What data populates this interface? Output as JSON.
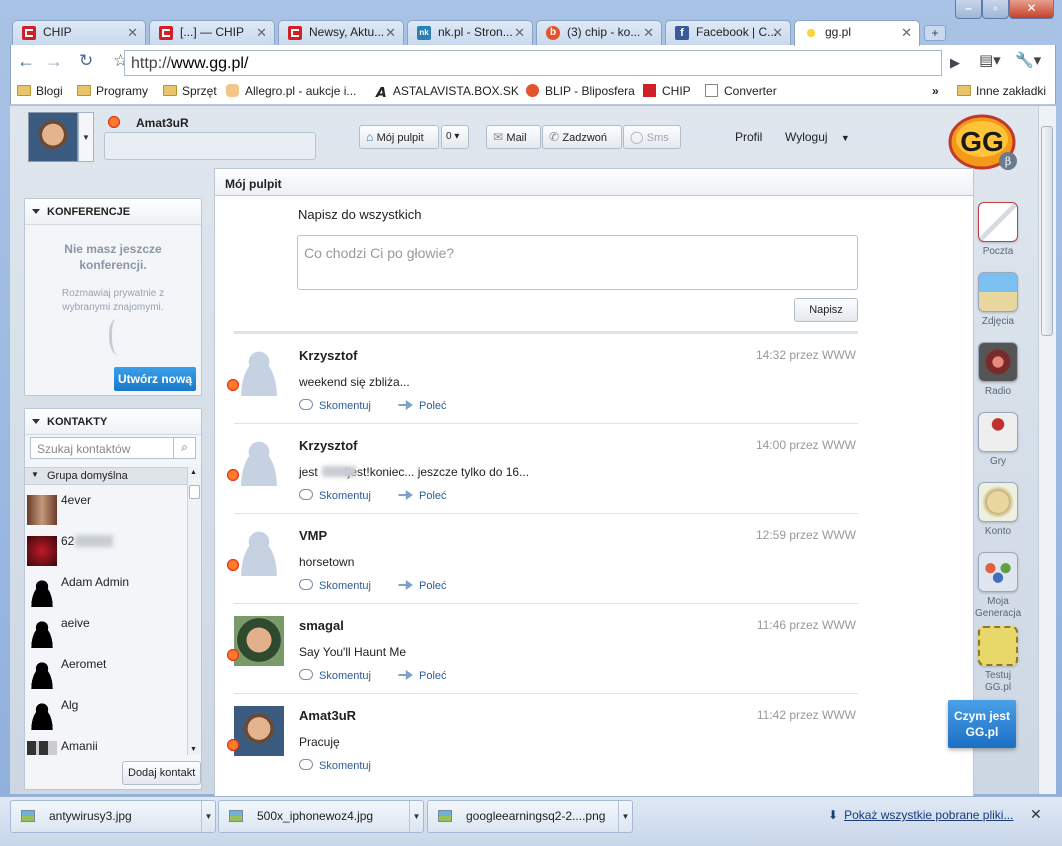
{
  "browser": {
    "tabs": [
      {
        "label": "CHIP",
        "icon": "chip-favicon"
      },
      {
        "label": "[...] — CHIP",
        "icon": "chip-favicon"
      },
      {
        "label": "Newsy, Aktu...",
        "icon": "chip-favicon"
      },
      {
        "label": "nk.pl - Stron...",
        "icon": "nk-favicon"
      },
      {
        "label": "(3) chip - ko...",
        "icon": "blip-favicon"
      },
      {
        "label": "Facebook | C...",
        "icon": "facebook-favicon"
      },
      {
        "label": "gg.pl",
        "icon": "gg-favicon",
        "active": true
      }
    ],
    "url_scheme": "http://",
    "url_host": "www.gg.pl/",
    "bookmarks": [
      {
        "label": "Blogi",
        "icon": "folder-icon"
      },
      {
        "label": "Programy",
        "icon": "folder-icon"
      },
      {
        "label": "Sprzęt",
        "icon": "folder-icon"
      },
      {
        "label": "Allegro.pl - aukcje i...",
        "icon": "allegro-hand-icon"
      },
      {
        "label": "ASTALAVISTA.BOX.SK",
        "icon": "astalavista-icon"
      },
      {
        "label": "BLIP - Bliposfera",
        "icon": "blip-favicon"
      },
      {
        "label": "CHIP",
        "icon": "chip-favicon"
      },
      {
        "label": "Converter",
        "icon": "page-icon"
      }
    ],
    "other_bookmarks": "Inne zakładki"
  },
  "gg": {
    "username": "Amat3uR",
    "nav": {
      "desktop": "Mój pulpit",
      "desktop_count": "0",
      "mail": "Mail",
      "call": "Zadzwoń",
      "sms": "Sms",
      "profile": "Profil",
      "logout": "Wyloguj"
    },
    "conferences": {
      "title": "KONFERENCJE",
      "empty": "Nie masz jeszcze konferencji.",
      "hint": "Rozmawiaj prywatnie z wybranymi znajomymi.",
      "create": "Utwórz nową"
    },
    "contacts": {
      "title": "KONTAKTY",
      "search_placeholder": "Szukaj kontaktów",
      "group": "Grupa domyślna",
      "add": "Dodaj kontakt",
      "items": [
        {
          "name": "4ever"
        },
        {
          "name": "62"
        },
        {
          "name": "Adam Admin"
        },
        {
          "name": "aeive"
        },
        {
          "name": "Aeromet"
        },
        {
          "name": "Alg"
        },
        {
          "name": "Amanii"
        }
      ]
    },
    "main": {
      "title": "Mój pulpit",
      "compose_label": "Napisz do wszystkich",
      "compose_placeholder": "Co chodzi Ci po głowie?",
      "compose_button": "Napisz",
      "comment": "Skomentuj",
      "recommend": "Poleć",
      "posts": [
        {
          "author": "Krzysztof",
          "time": "14:32 przez WWW",
          "text": "weekend się zbliża..."
        },
        {
          "author": "Krzysztof",
          "time": "14:00 przez WWW",
          "text": "jest        !jest!koniec... jeszcze tylko do 16..."
        },
        {
          "author": "VMP",
          "time": "12:59 przez WWW",
          "text": "horsetown"
        },
        {
          "author": "smagal",
          "time": "11:46 przez WWW",
          "text": "Say You'll Haunt Me"
        },
        {
          "author": "Amat3uR",
          "time": "11:42 przez WWW",
          "text": "Pracuję"
        }
      ]
    },
    "dock": [
      {
        "label": "Poczta"
      },
      {
        "label": "Zdjęcia"
      },
      {
        "label": "Radio"
      },
      {
        "label": "Gry"
      },
      {
        "label": "Konto"
      },
      {
        "label": "Moja Generacja"
      },
      {
        "label": "Testuj GG.pl"
      }
    ],
    "promo": "Czym jest GG.pl",
    "logo_text": "GG"
  },
  "downloads": {
    "items": [
      "antywirusy3.jpg",
      "500x_iphonewoz4.jpg",
      "googleearningsq2-2....png"
    ],
    "show_all": "Pokaż wszystkie pobrane pliki..."
  }
}
